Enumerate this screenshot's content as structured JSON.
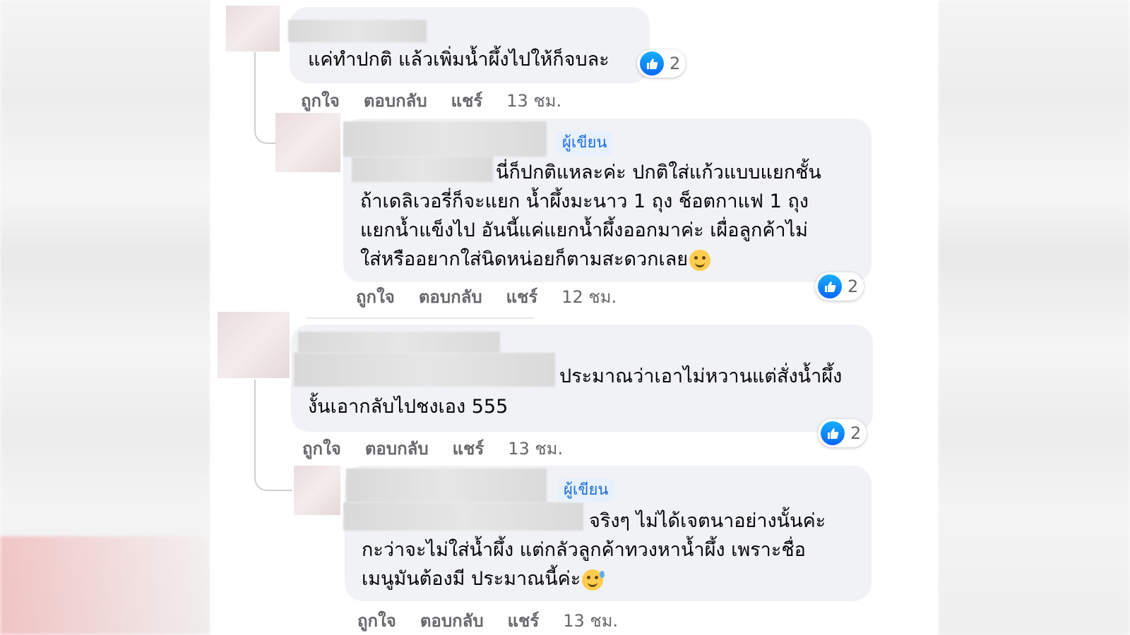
{
  "comments": [
    {
      "text_lines": [
        "แค่ทำปกติ แล้วเพิ่มน้ำผึ้งไปให้ก็จบละ"
      ],
      "reactions": "2",
      "actions": {
        "like": "ถูกใจ",
        "reply": "ตอบกลับ",
        "share": "แชร์",
        "time": "13 ชม."
      }
    },
    {
      "author_badge": "ผู้เขียน",
      "text_lines": [
        "นี่ก็ปกติแหละค่ะ ปกติใส่แก้วแบบแยกชั้น",
        "ถ้าเดลิเวอรี่ก็จะแยก น้ำผึ้งมะนาว 1 ถุง ช็อตกาแฟ 1 ถุง",
        "แยกน้ำแข็งไป อันนี้แค่แยกน้ำผึ้งออกมาค่ะ เผื่อลูกค้าไม่",
        "ใส่หรืออยากใส่นิดหน่อยก็ตามสะดวกเลย"
      ],
      "emoji": "smiling-face-icon",
      "reactions": "2",
      "actions": {
        "like": "ถูกใจ",
        "reply": "ตอบกลับ",
        "share": "แชร์",
        "time": "12 ชม."
      }
    },
    {
      "text_lines": [
        "ประมาณว่าเอาไม่หวานแต่สั่งน้ำผึ้ง",
        "งั้นเอากลับไปชงเอง 555"
      ],
      "reactions": "2",
      "actions": {
        "like": "ถูกใจ",
        "reply": "ตอบกลับ",
        "share": "แชร์",
        "time": "13 ชม."
      }
    },
    {
      "author_badge": "ผู้เขียน",
      "text_lines": [
        "จริงๆ ไม่ได้เจตนาอย่างนั้นค่ะ",
        "กะว่าจะไม่ใส่น้ำผึ้ง แต่กลัวลูกค้าทวงหาน้ำผึ้ง เพราะชื่อ",
        "เมนูมันต้องมี ประมาณนี้ค่ะ"
      ],
      "emoji": "sweat-smile-icon",
      "actions": {
        "like": "ถูกใจ",
        "reply": "ตอบกลับ",
        "share": "แชร์",
        "time": "13 ชม."
      }
    }
  ],
  "colors": {
    "bubble": "#f0f2f5",
    "like_blue": "#0866ff",
    "author_badge_text": "#1b6ad8",
    "meta_gray": "#65676b"
  }
}
